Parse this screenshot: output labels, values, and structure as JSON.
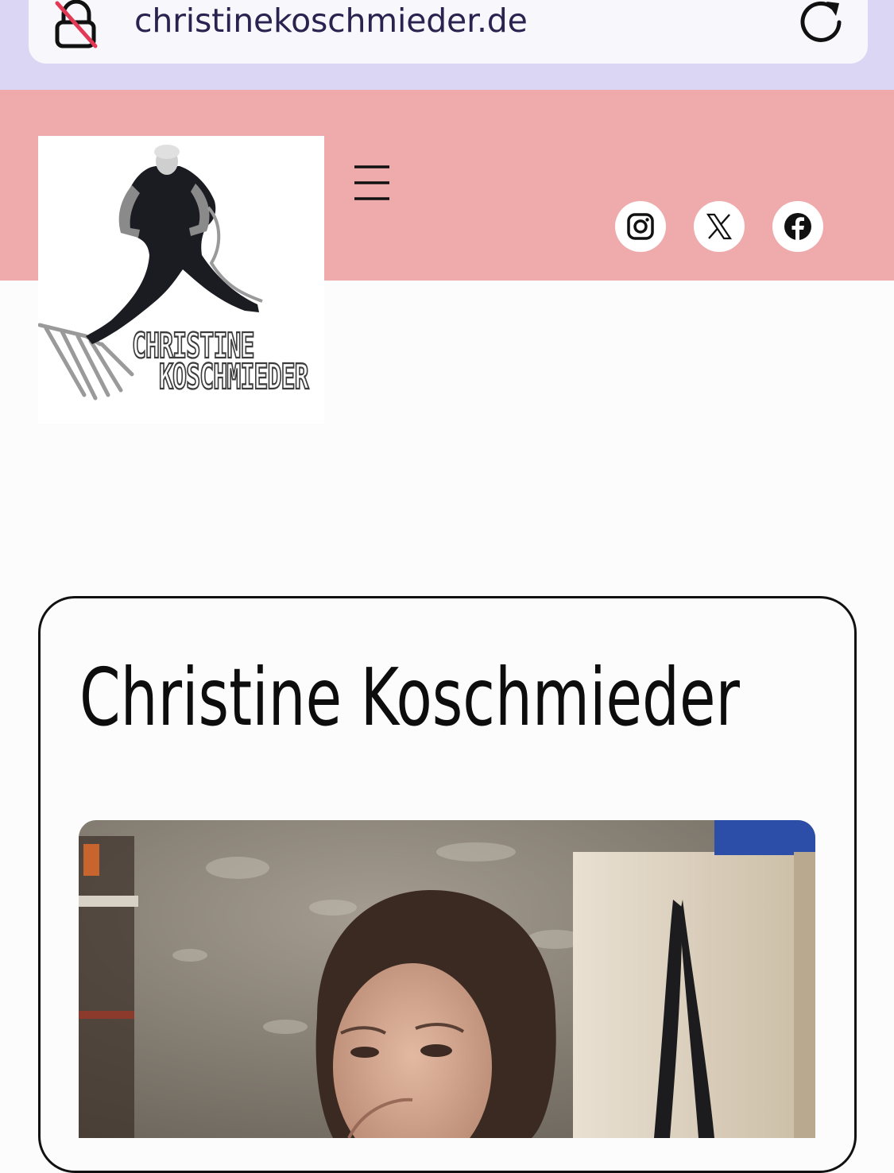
{
  "browser": {
    "url": "christinekoschmieder.de",
    "lock_icon": "lock-off-icon",
    "reload_icon": "reload-icon"
  },
  "header": {
    "logo": {
      "line1": "CHRISTINE",
      "line2": "KOSCHMIEDER"
    },
    "menu_icon": "hamburger-menu-icon",
    "social": [
      "instagram-icon",
      "x-icon",
      "facebook-icon"
    ]
  },
  "main": {
    "title": "Christine Koschmieder"
  },
  "colors": {
    "browser_bar": "#dad6f4",
    "header_bg": "#efaaab",
    "text_dark": "#0d0d0d",
    "url_text": "#2a2350"
  }
}
